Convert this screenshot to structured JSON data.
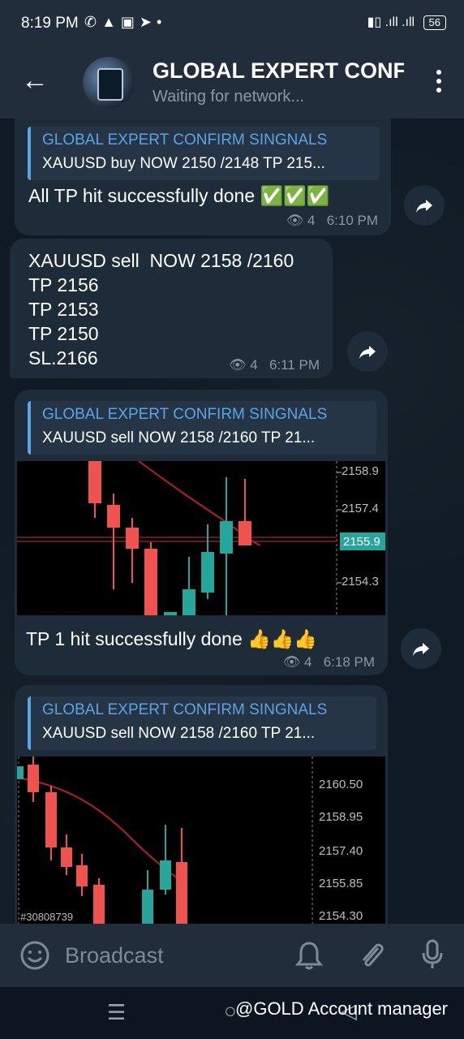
{
  "status_bar": {
    "time": "8:19 PM",
    "battery": "56"
  },
  "header": {
    "title": "GLOBAL EXPERT CONFI",
    "subtitle": "Waiting for network..."
  },
  "messages": [
    {
      "reply_title": "GLOBAL EXPERT CONFIRM SINGNALS",
      "reply_text": "XAUUSD buy NOW 2150  /2148 TP 215...",
      "text": "All TP hit successfully done ✅✅✅",
      "views": "4",
      "time": "6:10 PM"
    },
    {
      "text": "XAUUSD sell  NOW 2158 /2160\nTP 2156\nTP 2153\nTP 2150\nSL.2166",
      "views": "4",
      "time": "6:11 PM"
    },
    {
      "reply_title": "GLOBAL EXPERT CONFIRM SINGNALS",
      "reply_text": "XAUUSD sell  NOW 2158 /2160 TP 21...",
      "text": "TP 1 hit successfully done 👍👍👍",
      "views": "4",
      "time": "6:18 PM",
      "chart_labels": [
        "2158.9",
        "2157.4",
        "2155.9",
        "2154.3"
      ]
    },
    {
      "reply_title": "GLOBAL EXPERT CONFIRM SINGNALS",
      "reply_text": "XAUUSD sell  NOW 2158 /2160 TP 21...",
      "chart_labels": [
        "2160.50",
        "2158.95",
        "2157.40",
        "2155.85",
        "2154.30"
      ],
      "chart_footer": "#30808739"
    }
  ],
  "input": {
    "placeholder": "Broadcast"
  },
  "watermark": "@GOLD Account manager",
  "colors": {
    "accent": "#5aa4e6",
    "bubble": "#1e2c3a",
    "bull": "#26a69a",
    "bear": "#ef5350"
  }
}
